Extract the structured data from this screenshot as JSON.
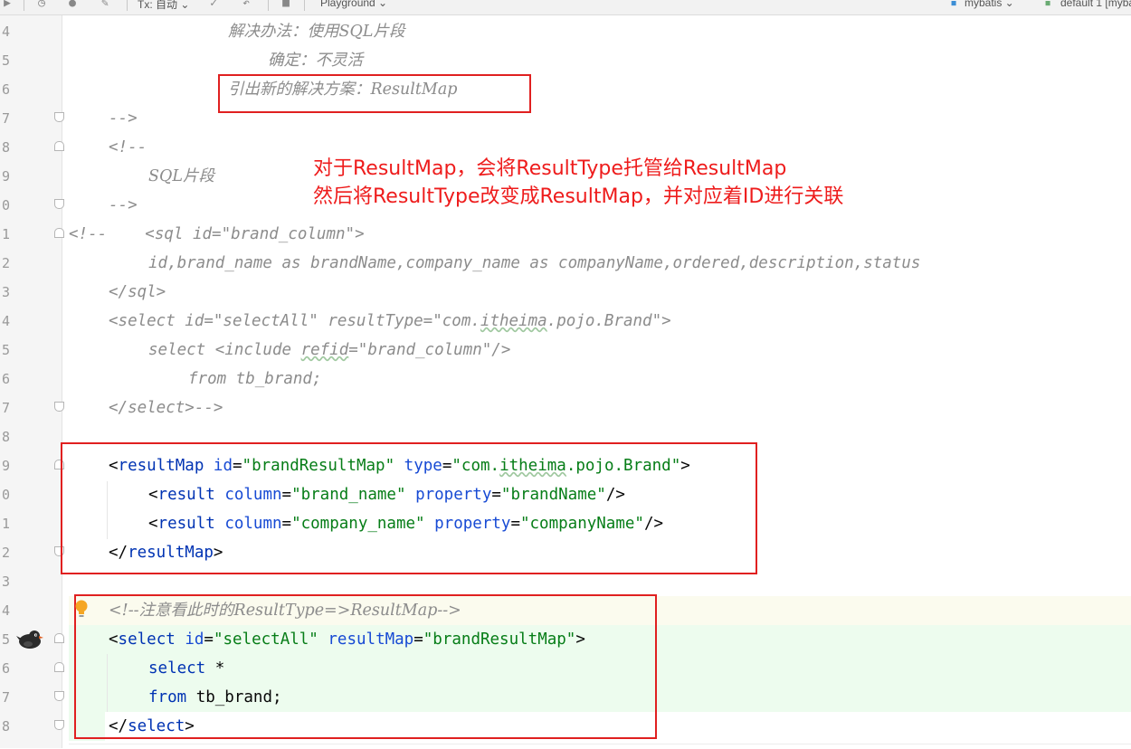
{
  "toolbar": {
    "tx_label": "Tx: 自动",
    "playground_label": "Playground",
    "datasource_label": "mybatis",
    "schema_label": "default 1 [myba"
  },
  "gutter": {
    "line_numbers": [
      "4",
      "5",
      "6",
      "7",
      "8",
      "9",
      "0",
      "1",
      "2",
      "3",
      "4",
      "5",
      "6",
      "7",
      "8",
      "9",
      "0",
      "1",
      "2",
      "3",
      "4",
      "5",
      "6",
      "7",
      "8"
    ]
  },
  "code": {
    "l4": "解决办法：使用SQL片段",
    "l5": "确定：不灵活",
    "l6": "引出新的解决方案：ResultMap",
    "l7": "-->",
    "l8": "<!--",
    "l9": "SQL片段",
    "l10": "-->",
    "l11": "<!--    <sql id=\"brand_column\">",
    "l12": "id,brand_name as brandName,company_name as companyName,ordered,description,status",
    "l13": "</sql>",
    "l14_a": "<select id=\"selectAll\" resultType=\"com.",
    "l14_b": "itheima",
    "l14_c": ".pojo.Brand\">",
    "l15_a": "select <include ",
    "l15_b": "refid",
    "l15_c": "=\"brand_column\"/>",
    "l16": "from tb_brand;",
    "l17": "</select>-->",
    "rm_open_lt": "<",
    "rm_open_tag": "resultMap",
    "rm_id_attr": "id",
    "rm_id_val": "\"brandResultMap\"",
    "rm_type_attr": "type",
    "rm_type_val_a": "\"com.",
    "rm_type_val_b": "itheima",
    "rm_type_val_c": ".pojo.Brand\"",
    "rm_open_gt": ">",
    "r1_lt": "<",
    "r1_tag": "result",
    "r1_col_attr": "column",
    "r1_col_val": "\"brand_name\"",
    "r1_prop_attr": "property",
    "r1_prop_val": "\"brandName\"",
    "r1_end": "/>",
    "r2_lt": "<",
    "r2_tag": "result",
    "r2_col_attr": "column",
    "r2_col_val": "\"company_name\"",
    "r2_prop_attr": "property",
    "r2_prop_val": "\"companyName\"",
    "r2_end": "/>",
    "rm_close_lt": "</",
    "rm_close_tag": "resultMap",
    "rm_close_gt": ">",
    "l24": "<!--注意看此时的ResultType=>ResultMap-->",
    "s_lt": "<",
    "s_tag": "select",
    "s_id_attr": "id",
    "s_id_val": "\"selectAll\"",
    "s_rm_attr": "resultMap",
    "s_rm_val": "\"brandResultMap\"",
    "s_gt": ">",
    "l26_kw": "select",
    "l26_rest": " *",
    "l27_kw": "from",
    "l27_rest": " tb_brand;",
    "s_close_lt": "</",
    "s_close_tag": "select",
    "s_close_gt": ">"
  },
  "annotation": {
    "line1": "对于ResultMap，会将ResultType托管给ResultMap",
    "line2": "然后将ResultType改变成ResultMap，并对应着ID进行关联"
  },
  "colors": {
    "annotation_red": "#ee1c1c",
    "box_red": "#e02020",
    "xml_tag": "#0033b3",
    "xml_value": "#067d17",
    "comment": "#8c8c8c"
  }
}
